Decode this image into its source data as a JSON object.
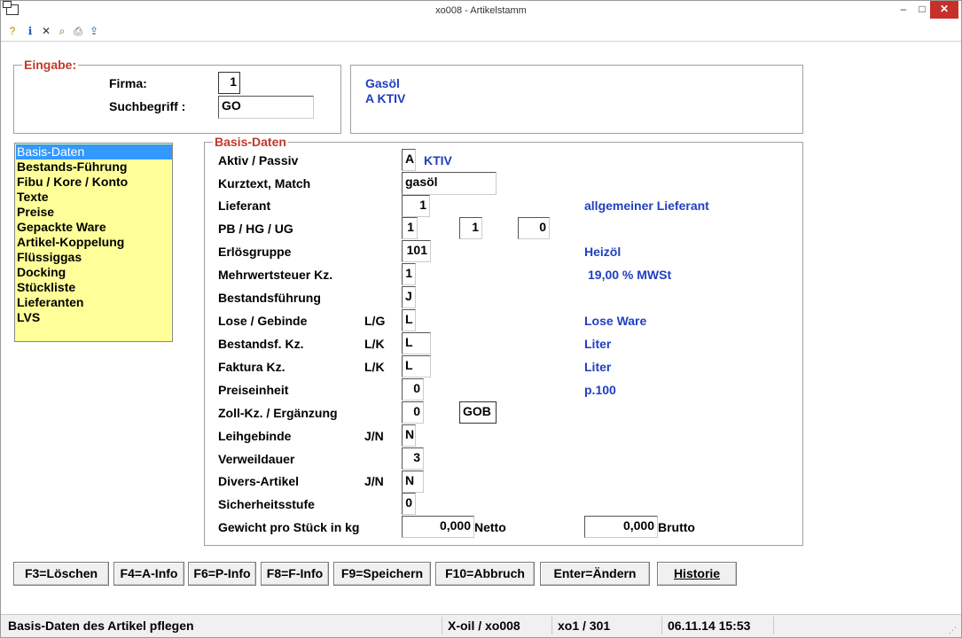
{
  "window": {
    "title": "xo008 - Artikelstamm",
    "min": "–",
    "max": "□",
    "close": "✕"
  },
  "toolbar": {
    "icons": [
      "help-icon",
      "info-icon",
      "delete-icon",
      "search-icon",
      "print-icon",
      "export-icon"
    ]
  },
  "eingabe": {
    "legend": "Eingabe:",
    "firma_label": "Firma:",
    "firma_value": "1",
    "suchbegriff_label": "Suchbegriff :",
    "suchbegriff_value": "GO",
    "info_line1": "Gasöl",
    "info_line2": "A  KTIV"
  },
  "nav": {
    "items": [
      "Basis-Daten",
      "Bestands-Führung",
      "Fibu / Kore / Konto",
      "Texte",
      "Preise",
      "Gepackte Ware",
      "Artikel-Koppelung",
      "Flüssiggas",
      "Docking",
      "Stückliste",
      "Lieferanten",
      "LVS"
    ],
    "selected": 0
  },
  "basis": {
    "legend": "Basis-Daten",
    "aktiv_label": "Aktiv / Passiv",
    "aktiv_value": "A",
    "aktiv_info": "KTIV",
    "kurztext_label": "Kurztext, Match",
    "kurztext_value": "gasöl",
    "lieferant_label": "Lieferant",
    "lieferant_value": "1",
    "lieferant_info": "allgemeiner Lieferant",
    "pb_label": "PB / HG / UG",
    "pb_value": "1",
    "hg_value": "1",
    "ug_value": "0",
    "erloes_label": "Erlösgruppe",
    "erloes_value": "101",
    "erloes_info": "Heizöl",
    "mwst_label": "Mehrwertsteuer Kz.",
    "mwst_value": "1",
    "mwst_info": "19,00 % MWSt",
    "bestandsf_label": "Bestandsführung",
    "bestandsf_value": "J",
    "lose_label": "Lose / Gebinde",
    "lose_code": "L/G",
    "lose_value": "L",
    "lose_info": "Lose Ware",
    "bkz_label": "Bestandsf. Kz.",
    "bkz_code": "L/K",
    "bkz_value": "L",
    "bkz_info": "Liter",
    "fkz_label": "Faktura Kz.",
    "fkz_code": "L/K",
    "fkz_value": "L",
    "fkz_info": "Liter",
    "preis_label": "Preiseinheit",
    "preis_value": "0",
    "preis_info": "p.100",
    "zoll_label": "Zoll-Kz. / Ergänzung",
    "zoll_value": "0",
    "zoll_erg_value": "GOB",
    "leih_label": "Leihgebinde",
    "leih_code": "J/N",
    "leih_value": "N",
    "verweil_label": "Verweildauer",
    "verweil_value": "3",
    "divers_label": "Divers-Artikel",
    "divers_code": "J/N",
    "divers_value": "N",
    "sicher_label": "Sicherheitsstufe",
    "sicher_value": "0",
    "gewicht_label": "Gewicht pro Stück in kg",
    "netto_value": "0,000",
    "netto_label": "Netto",
    "brutto_value": "0,000",
    "brutto_label": "Brutto"
  },
  "buttons": {
    "f3": "F3=Löschen",
    "f4": "F4=A-Info",
    "f6": "F6=P-Info",
    "f8": "F8=F-Info",
    "f9": "F9=Speichern",
    "f10": "F10=Abbruch",
    "enter": "Enter=Ändern",
    "historie": "Historie"
  },
  "status": {
    "message": "Basis-Daten des Artikel pflegen",
    "system": "X-oil / xo008",
    "user": "xo1 / 301",
    "datetime": "06.11.14 15:53"
  },
  "colors": {
    "legend": "#c0392b",
    "info": "#1f3fbf",
    "nav_bg": "#ffff99",
    "nav_selected": "#3399ff",
    "close": "#c7302a"
  }
}
